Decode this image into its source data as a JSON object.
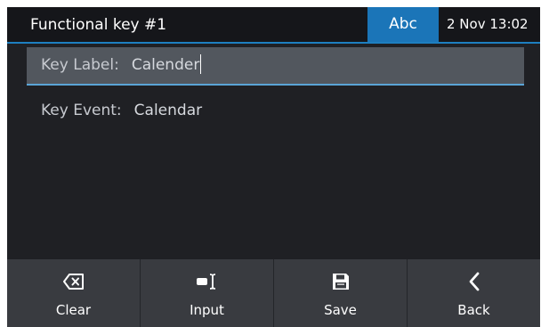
{
  "header": {
    "title": "Functional key #1",
    "input_mode": "Abc",
    "datetime": "2 Nov 13:02"
  },
  "fields": [
    {
      "label": "Key Label:",
      "value": "Calender",
      "selected": true
    },
    {
      "label": "Key Event:",
      "value": "Calendar",
      "selected": false
    }
  ],
  "softkeys": [
    {
      "label": "Clear",
      "icon": "backspace-icon"
    },
    {
      "label": "Input",
      "icon": "input-method-icon"
    },
    {
      "label": "Save",
      "icon": "save-icon"
    },
    {
      "label": "Back",
      "icon": "chevron-left-icon"
    }
  ],
  "colors": {
    "background": "#1f2024",
    "header": "#15161a",
    "accent": "#1b75b8",
    "selected_row": "#52575e",
    "softkey": "#393b40"
  }
}
